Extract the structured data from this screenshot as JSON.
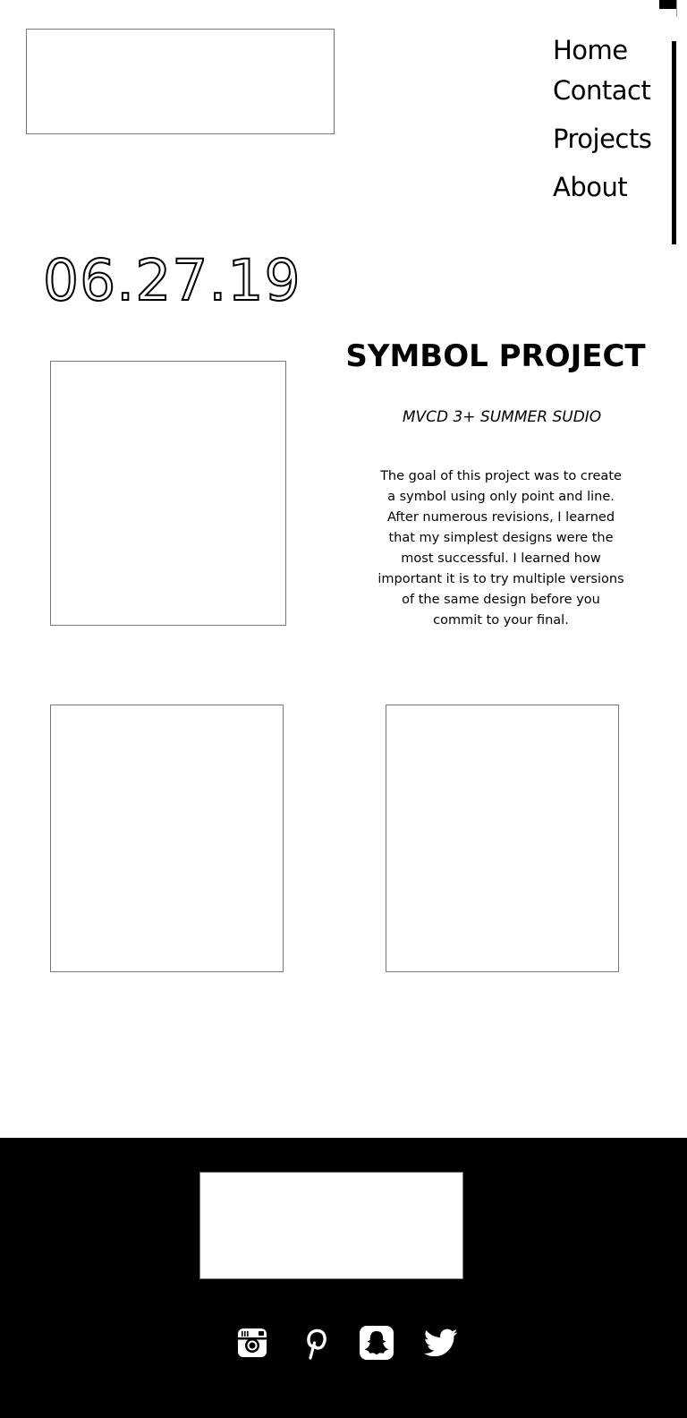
{
  "nav": {
    "items": [
      "Home",
      "Contact",
      "Projects",
      "About"
    ]
  },
  "post": {
    "date": "06.27.19",
    "title": "SYMBOL PROJECT",
    "subtitle": "MVCD 3+ SUMMER SUDIO",
    "description": "The goal of this project was to create a symbol using only point and line.  After numerous revisions, I learned that my simplest designs were the most successful. I learned how important it is to try multiple versions of the same design before you commit to your final."
  },
  "footer": {
    "social_icons": [
      "instagram-icon",
      "pinterest-icon",
      "snapchat-icon",
      "twitter-icon"
    ]
  },
  "colors": {
    "background": "#ffffff",
    "text": "#000000",
    "footer_background": "#000000",
    "placeholder_border": "#777777"
  }
}
